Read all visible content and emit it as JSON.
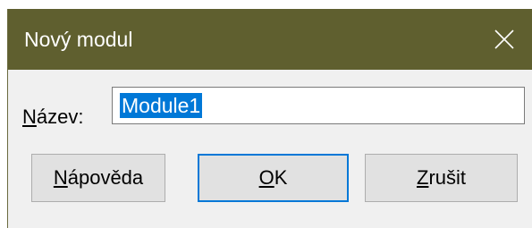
{
  "dialog": {
    "title": "Nový modul",
    "close_icon": "close-icon",
    "field": {
      "label_mnemonic": "N",
      "label_rest": "ázev:",
      "value": "Module1"
    },
    "buttons": {
      "help": {
        "mnemonic": "N",
        "rest": "ápověda"
      },
      "ok": {
        "mnemonic": "O",
        "rest": "K"
      },
      "cancel": {
        "mnemonic": "Z",
        "rest": "rušit"
      }
    }
  },
  "colors": {
    "titlebar": "#5f5f2f",
    "accent": "#0078d7",
    "dialog_background": "#f0f0f0"
  }
}
